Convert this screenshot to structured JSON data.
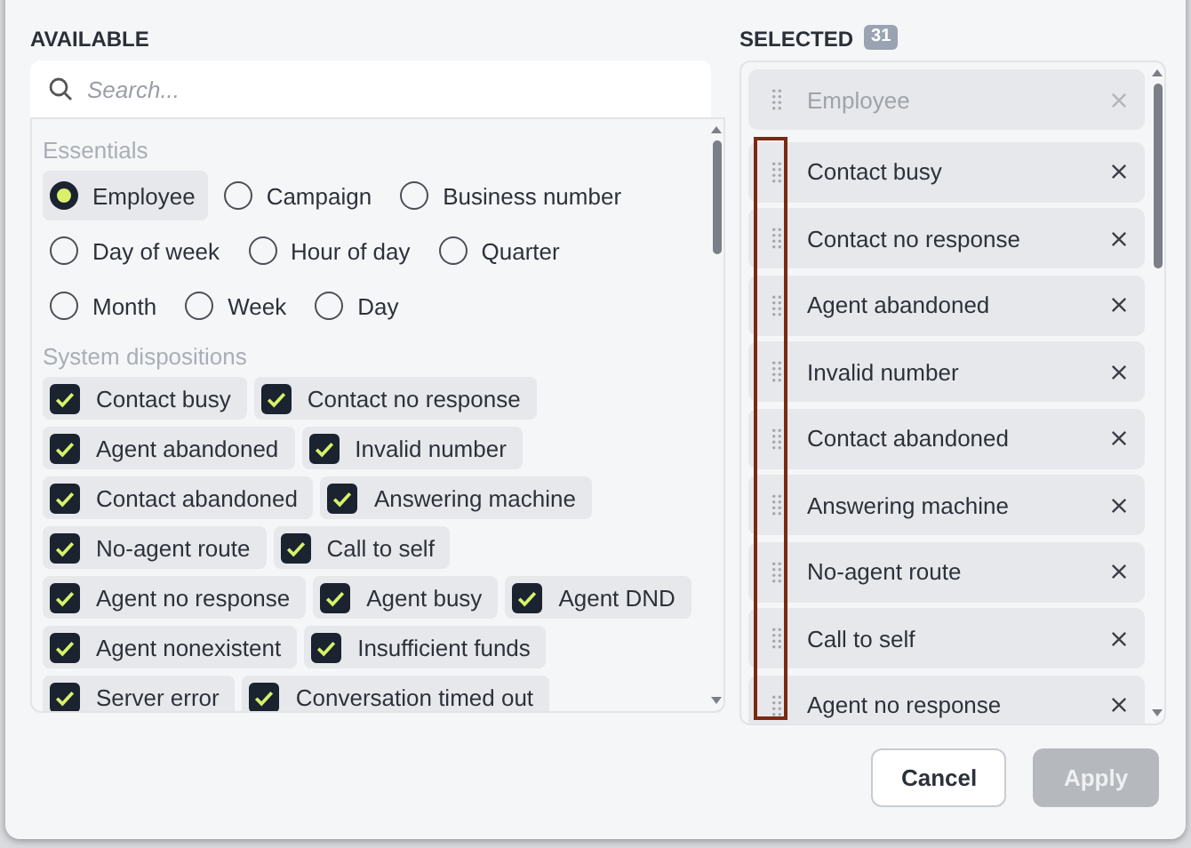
{
  "available": {
    "title": "AVAILABLE",
    "search": {
      "placeholder": "Search..."
    },
    "groups": [
      {
        "title": "Essentials",
        "kind": "radio",
        "items": [
          {
            "label": "Employee",
            "selected": true
          },
          {
            "label": "Campaign",
            "selected": false
          },
          {
            "label": "Business number",
            "selected": false
          },
          {
            "label": "Day of week",
            "selected": false
          },
          {
            "label": "Hour of day",
            "selected": false
          },
          {
            "label": "Quarter",
            "selected": false
          },
          {
            "label": "Month",
            "selected": false
          },
          {
            "label": "Week",
            "selected": false
          },
          {
            "label": "Day",
            "selected": false
          }
        ]
      },
      {
        "title": "System dispositions",
        "kind": "checkbox",
        "items": [
          {
            "label": "Contact busy",
            "checked": true
          },
          {
            "label": "Contact no response",
            "checked": true
          },
          {
            "label": "Agent abandoned",
            "checked": true
          },
          {
            "label": "Invalid number",
            "checked": true
          },
          {
            "label": "Contact abandoned",
            "checked": true
          },
          {
            "label": "Answering machine",
            "checked": true
          },
          {
            "label": "No-agent route",
            "checked": true
          },
          {
            "label": "Call to self",
            "checked": true
          },
          {
            "label": "Agent no response",
            "checked": true
          },
          {
            "label": "Agent busy",
            "checked": true
          },
          {
            "label": "Agent DND",
            "checked": true
          },
          {
            "label": "Agent nonexistent",
            "checked": true
          },
          {
            "label": "Insufficient funds",
            "checked": true
          },
          {
            "label": "Server error",
            "checked": true
          },
          {
            "label": "Conversation timed out",
            "checked": true
          }
        ]
      }
    ]
  },
  "selected": {
    "title": "SELECTED",
    "count": "31",
    "items": [
      {
        "label": "Employee",
        "disabled": true
      },
      {
        "label": "Contact busy",
        "disabled": false
      },
      {
        "label": "Contact no response",
        "disabled": false
      },
      {
        "label": "Agent abandoned",
        "disabled": false
      },
      {
        "label": "Invalid number",
        "disabled": false
      },
      {
        "label": "Contact abandoned",
        "disabled": false
      },
      {
        "label": "Answering machine",
        "disabled": false
      },
      {
        "label": "No-agent route",
        "disabled": false
      },
      {
        "label": "Call to self",
        "disabled": false
      },
      {
        "label": "Agent no response",
        "disabled": false
      }
    ]
  },
  "buttons": [
    {
      "label": "Cancel",
      "disabled": false
    },
    {
      "label": "Apply",
      "disabled": true
    }
  ]
}
